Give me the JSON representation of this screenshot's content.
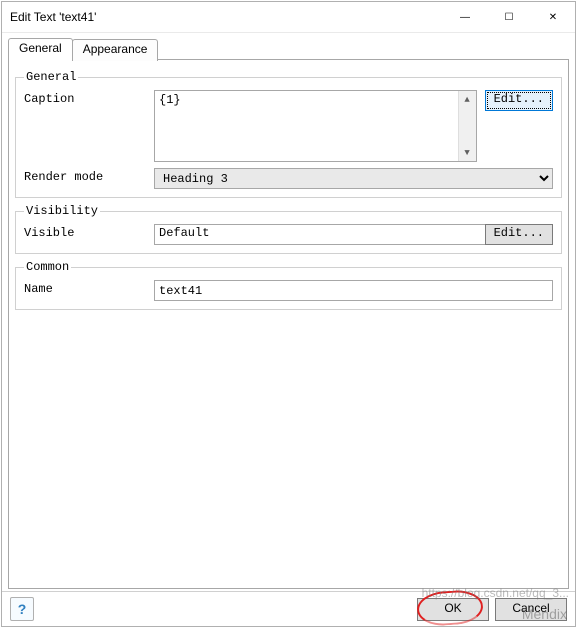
{
  "window": {
    "title": "Edit Text 'text41'",
    "min_icon": "—",
    "max_icon": "☐",
    "close_icon": "✕"
  },
  "tabs": {
    "general": "General",
    "appearance": "Appearance"
  },
  "group_general": {
    "legend": "General",
    "caption_label": "Caption",
    "caption_value": "{1}",
    "caption_edit": "Edit...",
    "render_label": "Render mode",
    "render_value": "Heading 3"
  },
  "group_visibility": {
    "legend": "Visibility",
    "visible_label": "Visible",
    "visible_value": "Default",
    "visible_edit": "Edit..."
  },
  "group_common": {
    "legend": "Common",
    "name_label": "Name",
    "name_value": "text41"
  },
  "footer": {
    "help": "?",
    "ok": "OK",
    "cancel": "Cancel"
  },
  "watermark": {
    "line1": "https://blog.csdn.net/qq_3...",
    "line2": "Mendix"
  }
}
